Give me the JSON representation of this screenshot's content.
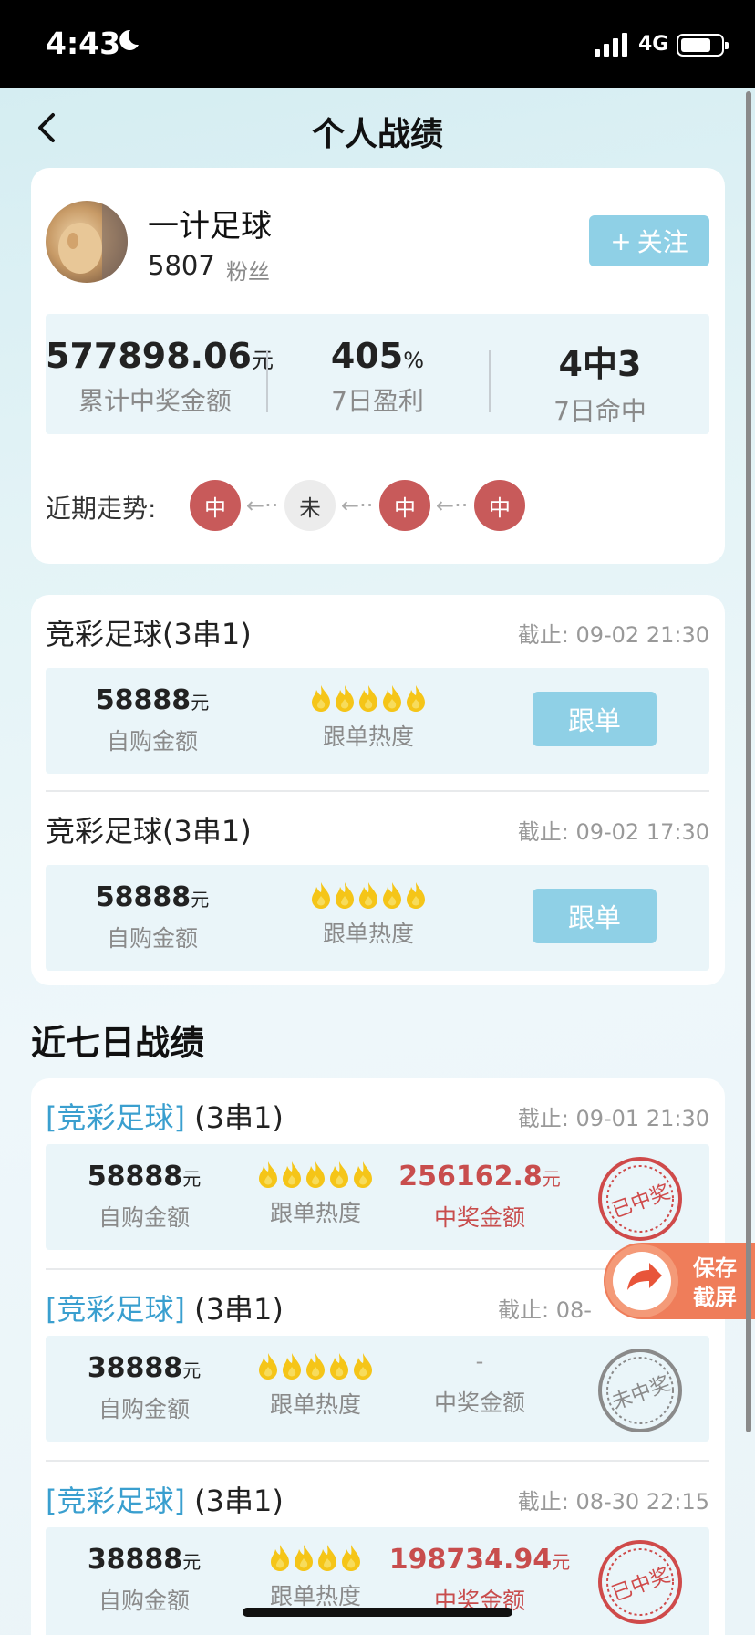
{
  "status_bar": {
    "time": "4:43",
    "network": "4G"
  },
  "header": {
    "title": "个人战绩"
  },
  "profile": {
    "name": "一计足球",
    "fans_count": "5807",
    "fans_label": "粉丝",
    "follow_label": "关注",
    "stats": [
      {
        "value": "577898.06",
        "unit": "元",
        "label": "累计中奖金额"
      },
      {
        "value": "405",
        "unit": "%",
        "label": "7日盈利"
      },
      {
        "value": "4中3",
        "unit": "",
        "label": "7日命中"
      }
    ],
    "trend_label": "近期走势:",
    "trend": [
      "中",
      "未",
      "中",
      "中"
    ]
  },
  "current_orders": [
    {
      "title": "竞彩足球(3串1)",
      "deadline": "截止:  09-02 21:30",
      "amount": "58888",
      "unit": "元",
      "amount_label": "自购金额",
      "heat_label": "跟单热度",
      "heat": 5,
      "button": "跟单"
    },
    {
      "title": "竞彩足球(3串1)",
      "deadline": "截止:  09-02 17:30",
      "amount": "58888",
      "unit": "元",
      "amount_label": "自购金额",
      "heat_label": "跟单热度",
      "heat": 5,
      "button": "跟单"
    }
  ],
  "history_title": "近七日战绩",
  "history": [
    {
      "tag": "[竞彩足球]",
      "type": "(3串1)",
      "deadline": "截止:  09-01 21:30",
      "amount": "58888",
      "unit": "元",
      "amount_label": "自购金额",
      "heat_label": "跟单热度",
      "heat": 5,
      "prize": "256162.8",
      "prize_unit": "元",
      "prize_label": "中奖金额",
      "result": "已中奖"
    },
    {
      "tag": "[竞彩足球]",
      "type": "(3串1)",
      "deadline": "截止:  08-",
      "amount": "38888",
      "unit": "元",
      "amount_label": "自购金额",
      "heat_label": "跟单热度",
      "heat": 5,
      "prize": "-",
      "prize_unit": "",
      "prize_label": "中奖金额",
      "result": "未中奖"
    },
    {
      "tag": "[竞彩足球]",
      "type": "(3串1)",
      "deadline": "截止:  08-30 22:15",
      "amount": "38888",
      "unit": "元",
      "amount_label": "自购金额",
      "heat_label": "跟单热度",
      "heat": 4,
      "prize": "198734.94",
      "prize_unit": "元",
      "prize_label": "中奖金额",
      "result": "已中奖"
    }
  ],
  "float_button": {
    "line1": "保存",
    "line2": "截屏"
  },
  "colors": {
    "accent": "#8fd0e6",
    "win_red": "#c84d4d",
    "panel_bg": "#eaf5f9",
    "bracket_blue": "#3a9fcf"
  }
}
